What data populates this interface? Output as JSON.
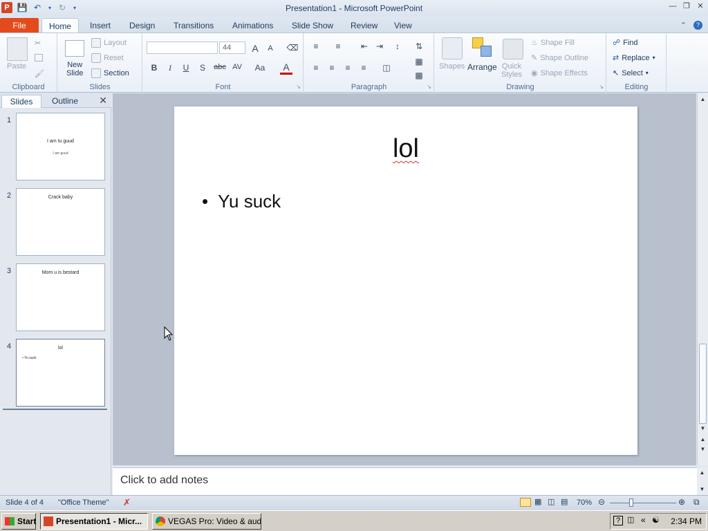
{
  "window": {
    "title": "Presentation1  -  Microsoft PowerPoint"
  },
  "tabs": {
    "file": "File",
    "items": [
      "Home",
      "Insert",
      "Design",
      "Transitions",
      "Animations",
      "Slide Show",
      "Review",
      "View"
    ]
  },
  "ribbon": {
    "clipboard": {
      "label": "Clipboard",
      "paste": "Paste"
    },
    "slides": {
      "label": "Slides",
      "new_slide": "New",
      "new_slide_2": "Slide",
      "layout": "Layout",
      "reset": "Reset",
      "section": "Section"
    },
    "font": {
      "label": "Font",
      "size": "44",
      "bold": "B",
      "italic": "I",
      "underline": "U",
      "shadow": "S",
      "strike": "abc",
      "spacing": "AV",
      "case": "Aa",
      "color": "A",
      "grow": "A",
      "shrink": "A"
    },
    "paragraph": {
      "label": "Paragraph"
    },
    "drawing": {
      "label": "Drawing",
      "shapes": "Shapes",
      "arrange": "Arrange",
      "quick_styles": "Quick",
      "quick_styles_2": "Styles",
      "shape_fill": "Shape Fill",
      "shape_outline": "Shape Outline",
      "shape_effects": "Shape Effects"
    },
    "editing": {
      "label": "Editing",
      "find": "Find",
      "replace": "Replace",
      "select": "Select"
    }
  },
  "panel": {
    "tab_slides": "Slides",
    "tab_outline": "Outline",
    "slides": [
      {
        "num": "1",
        "title": "I am tu guud",
        "subtitle": "I am guud"
      },
      {
        "num": "2",
        "title": "Crack baby"
      },
      {
        "num": "3",
        "title": "Mom u is bestard"
      },
      {
        "num": "4",
        "title": "lol",
        "bullet": "• Yu suck"
      }
    ]
  },
  "slide": {
    "title": "lol",
    "bullet_mark": "•",
    "bullet": "Yu suck"
  },
  "notes": {
    "placeholder": "Click to add notes"
  },
  "status": {
    "slide_count": "Slide 4 of 4",
    "theme": "\"Office Theme\"",
    "zoom": "70%",
    "zoom_level_percent": 70
  },
  "taskbar": {
    "start": "Start",
    "tasks": [
      "Presentation1 - Micr...",
      "VEGAS Pro: Video & audi..."
    ],
    "clock": "2:34 PM"
  },
  "colors": {
    "file_tab": "#e44b1c",
    "accent": "#2a5caa"
  }
}
